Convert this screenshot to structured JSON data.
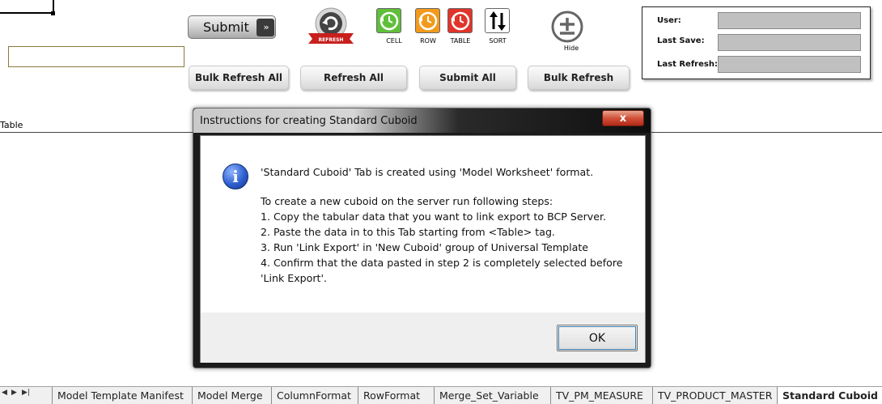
{
  "toolbar": {
    "submit_label": "Submit",
    "submit_arrow": "»",
    "refresh_icon_text": "REFRESH",
    "tools": [
      {
        "label": "CELL",
        "icon": "clock-refresh-icon",
        "color": "#5fbf3a"
      },
      {
        "label": "ROW",
        "icon": "clock-refresh-icon",
        "color": "#f39a1c"
      },
      {
        "label": "TABLE",
        "icon": "clock-refresh-icon",
        "color": "#e0352b"
      },
      {
        "label": "SORT",
        "icon": "sort-arrows-icon",
        "color": "#ffffff"
      }
    ],
    "hide_label": "Hide",
    "buttons": [
      "Bulk Refresh All",
      "Refresh All",
      "Submit All",
      "Bulk Refresh"
    ]
  },
  "status_panel": {
    "user_label": "User:",
    "last_save_label": "Last Save:",
    "last_refresh_label": "Last Refresh:",
    "user_value": "",
    "last_save_value": "",
    "last_refresh_value": ""
  },
  "sheet": {
    "table_tag": "Table"
  },
  "dialog": {
    "title": "Instructions for creating Standard Cuboid",
    "close": "x",
    "icon": "info-icon",
    "lines": [
      "'Standard Cuboid' Tab is created using 'Model Worksheet' format.",
      "To create a new cuboid on the server run following steps:",
      "1. Copy the tabular data that you want to link export to BCP Server.",
      "2. Paste the data in to this Tab starting from <Table> tag.",
      "3. Run 'Link Export' in 'New Cuboid' group of Universal Template",
      "4. Confirm that the data pasted  in step 2 is completely selected before",
      "'Link Export'."
    ],
    "ok_label": "OK"
  },
  "tabs": {
    "nav": [
      "◀",
      "▶",
      "▶|"
    ],
    "items": [
      "Model Template Manifest",
      "Model Merge",
      "ColumnFormat",
      "RowFormat",
      "Merge_Set_Variable",
      "TV_PM_MEASURE",
      "TV_PRODUCT_MASTER",
      "Standard Cuboid"
    ],
    "active": "Standard Cuboid"
  }
}
